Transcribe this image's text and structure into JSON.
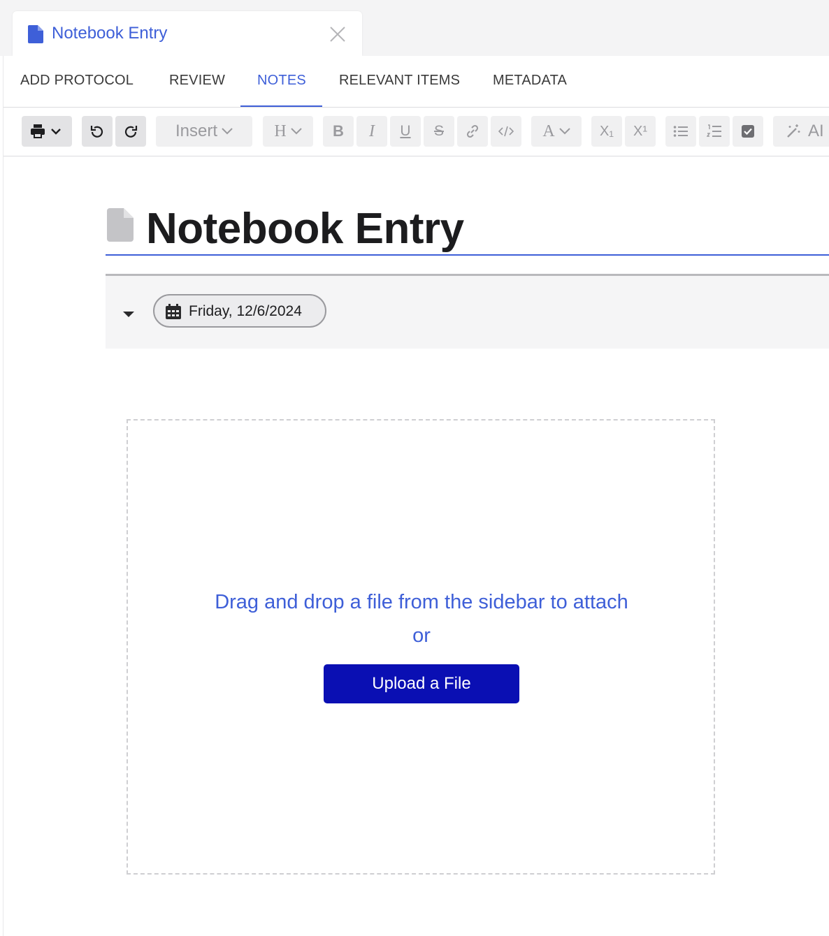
{
  "tab": {
    "title": "Notebook Entry"
  },
  "nav": {
    "items": [
      {
        "label": "ADD PROTOCOL"
      },
      {
        "label": "REVIEW"
      },
      {
        "label": "NOTES"
      },
      {
        "label": "RELEVANT ITEMS"
      },
      {
        "label": "METADATA"
      }
    ],
    "active": "NOTES"
  },
  "toolbar": {
    "insert_label": "Insert",
    "heading_label": "H",
    "bold_label": "B",
    "italic_label": "I",
    "underline_label": "U",
    "strike_label": "S",
    "font_color_label": "A",
    "subscript_label": "X₁",
    "superscript_label": "X¹",
    "ai_label": "AI",
    "icons": [
      "print-icon",
      "undo-icon",
      "redo-icon",
      "link-icon",
      "code-icon",
      "bullet-list-icon",
      "numbered-list-icon",
      "checkbox-icon",
      "magic-wand-icon"
    ]
  },
  "entry": {
    "title": "Notebook Entry",
    "date": "Friday, 12/6/2024"
  },
  "dropzone": {
    "text": "Drag and drop a file from the sidebar to attach or",
    "button_label": "Upload a File"
  },
  "colors": {
    "accent": "#3e5fd8",
    "upload_button": "#0a0fb3"
  }
}
